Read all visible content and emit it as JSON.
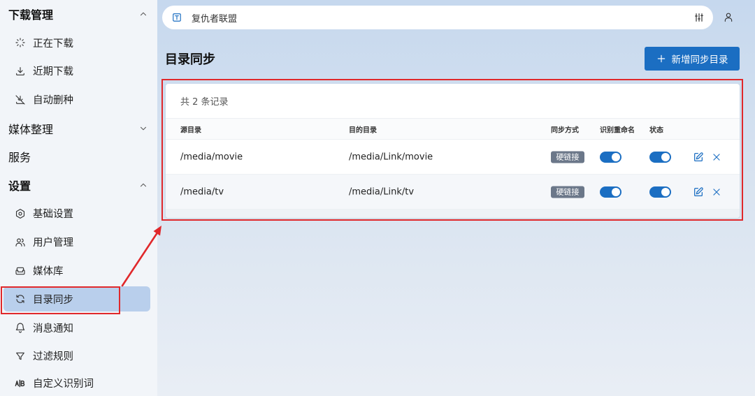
{
  "sidebar": {
    "items": [
      {
        "label": "下载管理",
        "expanded": true,
        "icon": "chevron-up-icon"
      },
      {
        "label": "正在下载",
        "icon": "loading-icon"
      },
      {
        "label": "近期下载",
        "icon": "download-icon"
      },
      {
        "label": "自动删种",
        "icon": "download-off-icon"
      },
      {
        "label": "媒体整理",
        "expanded": false,
        "icon": "chevron-down-icon"
      },
      {
        "label": "服务"
      },
      {
        "label": "设置",
        "expanded": true,
        "icon": "chevron-up-icon"
      },
      {
        "label": "基础设置",
        "icon": "gear-icon"
      },
      {
        "label": "用户管理",
        "icon": "users-icon"
      },
      {
        "label": "媒体库",
        "icon": "media-library-icon"
      },
      {
        "label": "目录同步",
        "icon": "sync-icon",
        "active": true
      },
      {
        "label": "消息通知",
        "icon": "bell-icon"
      },
      {
        "label": "过滤规则",
        "icon": "filter-icon"
      },
      {
        "label": "自定义识别词",
        "icon": "ab-icon"
      }
    ]
  },
  "topbar": {
    "search_icon": "text-icon",
    "search_value": "复仇者联盟",
    "filter_icon": "tune-icon",
    "user_icon": "user-icon"
  },
  "page": {
    "title": "目录同步",
    "add_button": {
      "label": "新增同步目录",
      "icon": "plus-icon"
    }
  },
  "table": {
    "summary": "共 2 条记录",
    "columns": [
      "源目录",
      "目的目录",
      "同步方式",
      "识别重命名",
      "状态"
    ],
    "rows": [
      {
        "source": "/media/movie",
        "destination": "/media/Link/movie",
        "sync_mode": "硬链接",
        "rename": true,
        "enabled": true,
        "actions": [
          "edit-icon",
          "close-icon"
        ]
      },
      {
        "source": "/media/tv",
        "destination": "/media/Link/tv",
        "sync_mode": "硬链接",
        "rename": true,
        "enabled": true,
        "actions": [
          "edit-icon",
          "close-icon"
        ]
      }
    ]
  },
  "colors": {
    "accent": "#1b6ec2",
    "badge": "#6b7789",
    "active_item": "#b9cfec",
    "annotation": "#e0282b"
  }
}
